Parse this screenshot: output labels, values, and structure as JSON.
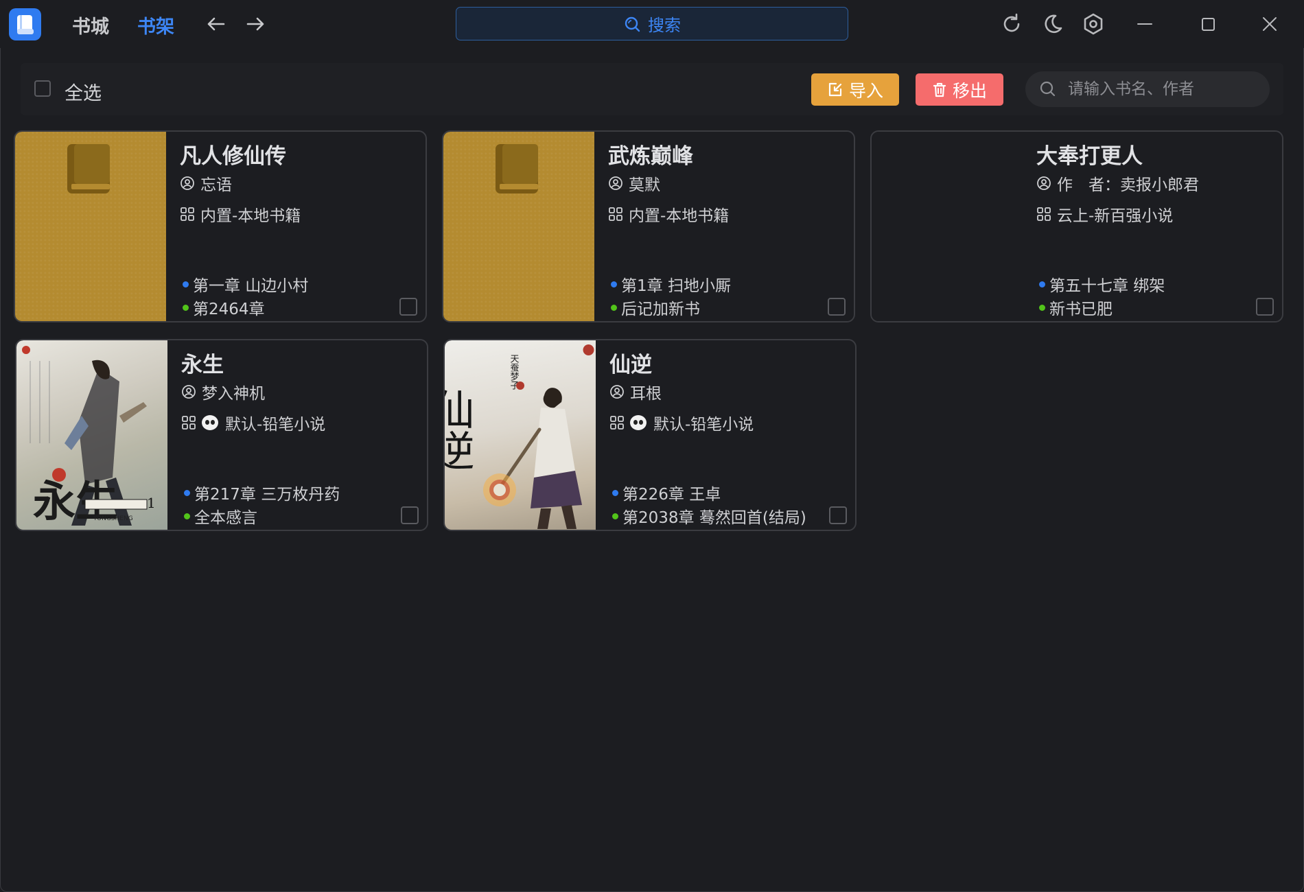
{
  "nav": {
    "bookstore": "书城",
    "bookshelf": "书架"
  },
  "search_top": {
    "label": "搜索"
  },
  "toolbar": {
    "select_all": "全选",
    "import_label": "导入",
    "remove_label": "移出",
    "search_placeholder": "请输入书名、作者"
  },
  "books": [
    {
      "title": "凡人修仙传",
      "author": "忘语",
      "source": "内置-本地书籍",
      "read_chapter": "第一章 山边小村",
      "latest_chapter": "第2464章"
    },
    {
      "title": "武炼巅峰",
      "author": "莫默",
      "source": "内置-本地书籍",
      "read_chapter": "第1章 扫地小厮",
      "latest_chapter": "后记加新书"
    },
    {
      "title": "大奉打更人",
      "author": "作　者：卖报小郎君",
      "source": "云上-新百强小说",
      "read_chapter": "第五十七章 绑架",
      "latest_chapter": "新书已肥"
    },
    {
      "title": "永生",
      "author": "梦入神机",
      "source": "默认-铅笔小说",
      "read_chapter": "第217章 三万枚丹药",
      "latest_chapter": "全本感言",
      "cover_text": [
        "永生",
        "YONGSHENG"
      ]
    },
    {
      "title": "仙逆",
      "author": "耳根",
      "source": "默认-铅笔小说",
      "read_chapter": "第226章 王卓",
      "latest_chapter": "第2038章 蓦然回首(结局)",
      "cover_text": [
        "仙逆",
        "天蚕梦子"
      ]
    }
  ],
  "colors": {
    "accent": "#2f7bf0",
    "import": "#e6a23c",
    "remove": "#f56c6c",
    "default_cover": "#b48b30",
    "read_dot": "#2f7bf0",
    "latest_dot": "#52c41a"
  }
}
